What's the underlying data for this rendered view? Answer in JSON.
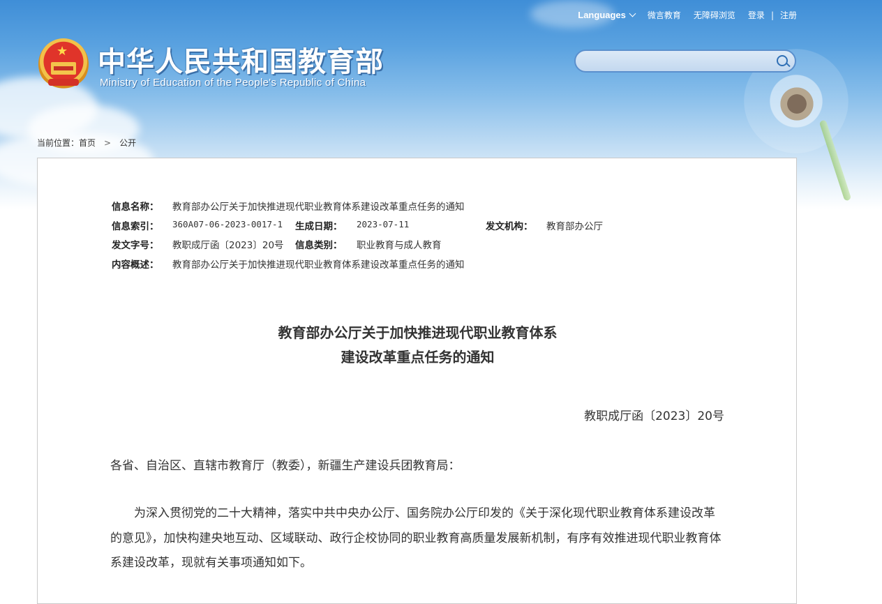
{
  "header": {
    "nav": {
      "languages": "Languages",
      "weiyan": "微言教育",
      "accessibility": "无障碍浏览",
      "login": "登录",
      "separator": "|",
      "register": "注册"
    },
    "title_cn": "中华人民共和国教育部",
    "title_en": "Ministry of Education of the People's Republic of China",
    "search": {
      "placeholder": "",
      "value": ""
    }
  },
  "breadcrumb": {
    "prefix": "当前位置：",
    "items": [
      "首页",
      "公开"
    ],
    "separator": ">"
  },
  "meta": {
    "name_label": "信息名称：",
    "name_value": "教育部办公厅关于加快推进现代职业教育体系建设改革重点任务的通知",
    "index_label": "信息索引：",
    "index_value": "360A07-06-2023-0017-1",
    "date_label": "生成日期：",
    "date_value": "2023-07-11",
    "org_label": "发文机构：",
    "org_value": "教育部办公厅",
    "docno_label": "发文字号：",
    "docno_value": "教职成厅函〔2023〕20号",
    "category_label": "信息类别：",
    "category_value": "职业教育与成人教育",
    "summary_label": "内容概述：",
    "summary_value": "教育部办公厅关于加快推进现代职业教育体系建设改革重点任务的通知"
  },
  "document": {
    "title_line1": "教育部办公厅关于加快推进现代职业教育体系",
    "title_line2": "建设改革重点任务的通知",
    "number": "教职成厅函〔2023〕20号",
    "salutation": "各省、自治区、直辖市教育厅（教委），新疆生产建设兵团教育局：",
    "paragraph1": "为深入贯彻党的二十大精神，落实中共中央办公厅、国务院办公厅印发的《关于深化现代职业教育体系建设改革的意见》，加快构建央地互动、区域联动、政行企校协同的职业教育高质量发展新机制，有序有效推进现代职业教育体系建设改革，现就有关事项通知如下。"
  }
}
